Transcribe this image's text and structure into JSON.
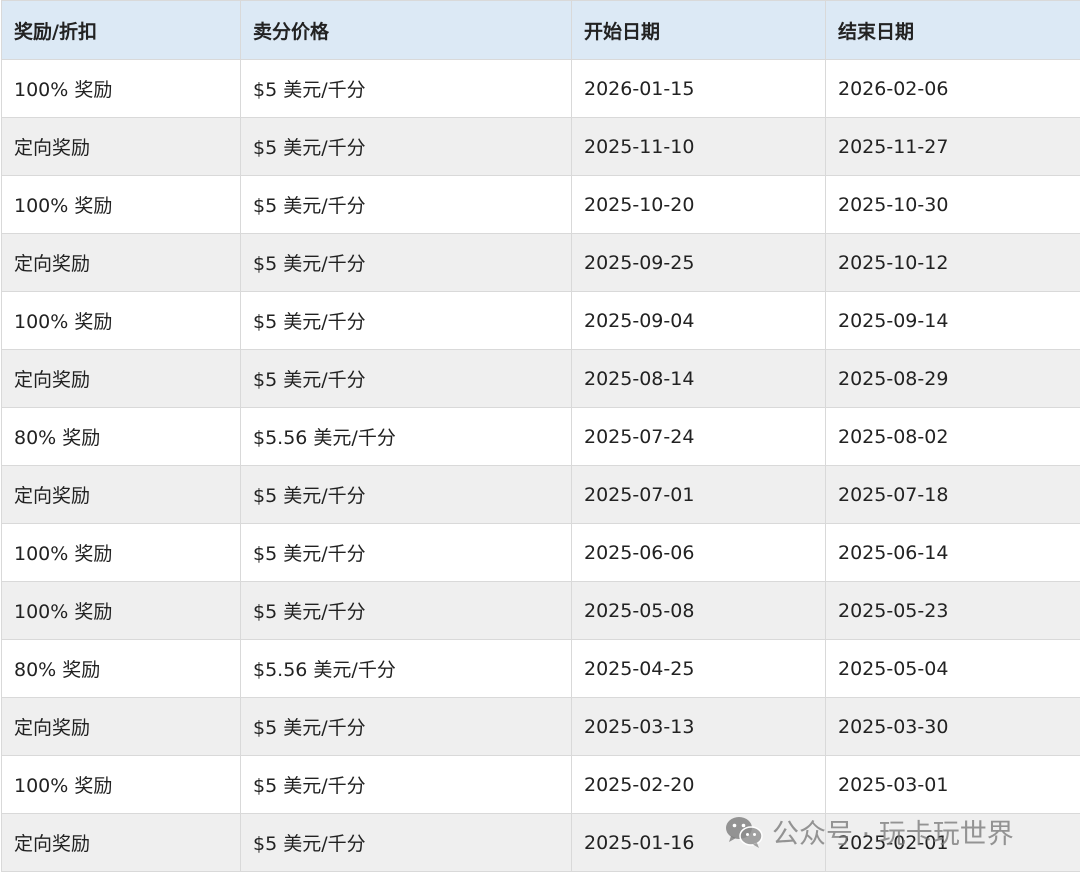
{
  "table": {
    "headers": [
      "奖励/折扣",
      "卖分价格",
      "开始日期",
      "结束日期"
    ],
    "rows": [
      [
        "100% 奖励",
        "$5 美元/千分",
        "2026-01-15",
        "2026-02-06"
      ],
      [
        "定向奖励",
        "$5 美元/千分",
        "2025-11-10",
        "2025-11-27"
      ],
      [
        "100% 奖励",
        "$5 美元/千分",
        "2025-10-20",
        "2025-10-30"
      ],
      [
        "定向奖励",
        "$5 美元/千分",
        "2025-09-25",
        "2025-10-12"
      ],
      [
        "100% 奖励",
        "$5 美元/千分",
        "2025-09-04",
        "2025-09-14"
      ],
      [
        "定向奖励",
        "$5 美元/千分",
        "2025-08-14",
        "2025-08-29"
      ],
      [
        "80% 奖励",
        "$5.56 美元/千分",
        "2025-07-24",
        "2025-08-02"
      ],
      [
        "定向奖励",
        "$5 美元/千分",
        "2025-07-01",
        "2025-07-18"
      ],
      [
        "100% 奖励",
        "$5 美元/千分",
        "2025-06-06",
        "2025-06-14"
      ],
      [
        "100% 奖励",
        "$5 美元/千分",
        "2025-05-08",
        "2025-05-23"
      ],
      [
        "80% 奖励",
        "$5.56 美元/千分",
        "2025-04-25",
        "2025-05-04"
      ],
      [
        "定向奖励",
        "$5 美元/千分",
        "2025-03-13",
        "2025-03-30"
      ],
      [
        "100% 奖励",
        "$5 美元/千分",
        "2025-02-20",
        "2025-03-01"
      ],
      [
        "定向奖励",
        "$5 美元/千分",
        "2025-01-16",
        "2025-02-01"
      ]
    ]
  },
  "watermark": {
    "text": "公众号 · 玩卡玩世界",
    "icon": "wechat-icon"
  },
  "colors": {
    "header_bg": "#dce9f5",
    "stripe_bg": "#efefef",
    "border": "#d9d9d9",
    "text": "#222222"
  }
}
